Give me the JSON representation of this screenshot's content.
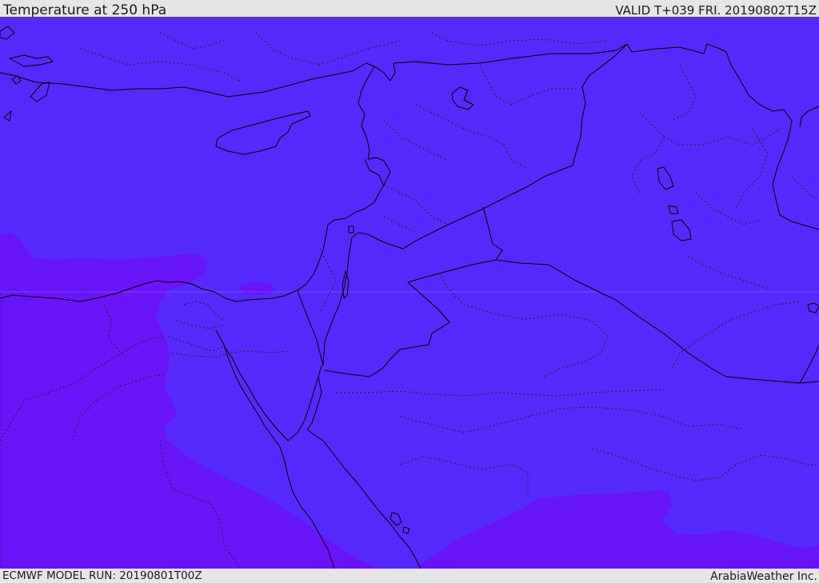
{
  "header": {
    "title": "Temperature at 250 hPa",
    "valid": "VALID T+039 FRI. 20190802T15Z"
  },
  "footer": {
    "model_run": "ECMWF MODEL RUN: 20190801T00Z",
    "credit": "ArabiaWeather Inc."
  },
  "map": {
    "field": "temperature",
    "level": "250 hPa",
    "colors": {
      "base_fill": "#5529fc",
      "warm_fill": "#6714f8",
      "coastline": "#000000",
      "border_dotted": "#202040",
      "grid_line": "#8a7cff"
    }
  }
}
